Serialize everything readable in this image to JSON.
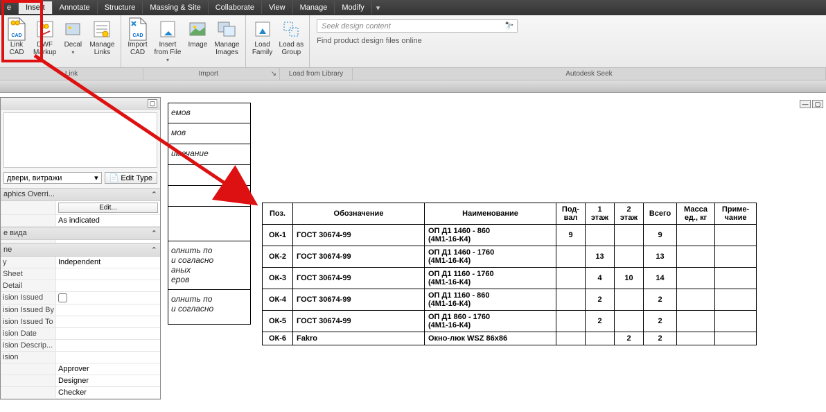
{
  "tabs": {
    "t0": "e",
    "insert": "Insert",
    "annotate": "Annotate",
    "structure": "Structure",
    "massing": "Massing & Site",
    "collaborate": "Collaborate",
    "view": "View",
    "manage": "Manage",
    "modify": "Modify"
  },
  "ribbon": {
    "link_cad": "Link\nCAD",
    "dwf": "DWF\nMarkup",
    "decal": "Decal",
    "manage_links": "Manage\nLinks",
    "import_cad": "Import\nCAD",
    "insert_file": "Insert\nfrom File",
    "image": "Image",
    "manage_images": "Manage\nImages",
    "load_family": "Load\nFamily",
    "load_group": "Load as\nGroup",
    "seek_placeholder": "Seek design content",
    "seek_text": "Find product design files online"
  },
  "groups": {
    "link": "Link",
    "import": "Import",
    "load": "Load from Library",
    "seek": "Autodesk Seek"
  },
  "props": {
    "type_sel": "двери, витражи",
    "edit_type": "Edit Type",
    "sec_graphics": "aphics Overri...",
    "edit": "Edit...",
    "as_indicated": "As indicated",
    "vida": "е вида",
    "me": "ne",
    "y": "y",
    "independent": "Independent",
    "sheet": "Sheet",
    "detail": "Detail",
    "r_issued": "ision Issued",
    "r_by": "ision Issued By",
    "r_to": "ision Issued To",
    "r_date": "ision Date",
    "r_desc": "ision Descrip...",
    "ision": "ision",
    "approver": "Approver",
    "designer": "Designer",
    "checker": "Checker"
  },
  "titleblock": {
    "r1": "емов",
    "r2": "мов",
    "r3": "имечание",
    "r4": "",
    "r5": "",
    "r6": "",
    "r7": "олнить по\nи согласно\nаных\nеров",
    "r8": "олнить по\nи согласно"
  },
  "table": {
    "h_poz": "Поз.",
    "h_des": "Обозначение",
    "h_name": "Наименование",
    "h_pod": "Под-\nвал",
    "h_f1": "1\nэтаж",
    "h_f2": "2\nэтаж",
    "h_total": "Всего",
    "h_mass": "Масса\nед., кг",
    "h_note": "Приме-\nчание",
    "rows": [
      {
        "poz": "ОК-1",
        "des": "ГОСТ 30674-99",
        "name": "ОП Д1 1460 - 860\n(4М1-16-К4)",
        "pod": "9",
        "f1": "",
        "f2": "",
        "tot": "9"
      },
      {
        "poz": "ОК-2",
        "des": "ГОСТ 30674-99",
        "name": "ОП Д1 1460 - 1760\n(4М1-16-К4)",
        "pod": "",
        "f1": "13",
        "f2": "",
        "tot": "13"
      },
      {
        "poz": "ОК-3",
        "des": "ГОСТ 30674-99",
        "name": "ОП Д1 1160 - 1760\n(4М1-16-К4)",
        "pod": "",
        "f1": "4",
        "f2": "10",
        "tot": "14"
      },
      {
        "poz": "ОК-4",
        "des": "ГОСТ 30674-99",
        "name": "ОП Д1 1160 - 860\n(4М1-16-К4)",
        "pod": "",
        "f1": "2",
        "f2": "",
        "tot": "2"
      },
      {
        "poz": "ОК-5",
        "des": "ГОСТ 30674-99",
        "name": "ОП Д1 860 - 1760\n(4М1-16-К4)",
        "pod": "",
        "f1": "2",
        "f2": "",
        "tot": "2"
      },
      {
        "poz": "ОК-6",
        "des": "Fakro",
        "name": "Окно-люк WSZ 86x86",
        "pod": "",
        "f1": "",
        "f2": "2",
        "tot": "2"
      }
    ]
  }
}
